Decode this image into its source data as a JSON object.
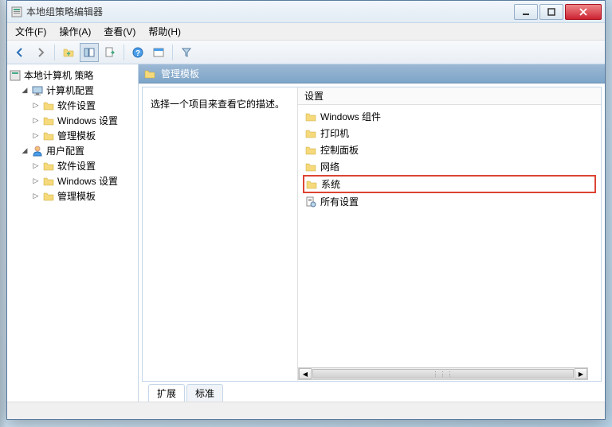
{
  "window": {
    "title": "本地组策略编辑器"
  },
  "menubar": {
    "file": "文件(F)",
    "action": "操作(A)",
    "view": "查看(V)",
    "help": "帮助(H)"
  },
  "tree": {
    "root": "本地计算机 策略",
    "computer_config": "计算机配置",
    "cc_software": "软件设置",
    "cc_windows": "Windows 设置",
    "cc_templates": "管理模板",
    "user_config": "用户配置",
    "uc_software": "软件设置",
    "uc_windows": "Windows 设置",
    "uc_templates": "管理模板"
  },
  "content": {
    "header": "管理模板",
    "description": "选择一个项目来查看它的描述。",
    "column_header": "设置",
    "items": {
      "windows_components": "Windows 组件",
      "printers": "打印机",
      "control_panel": "控制面板",
      "network": "网络",
      "system": "系统",
      "all_settings": "所有设置"
    }
  },
  "tabs": {
    "extended": "扩展",
    "standard": "标准"
  }
}
